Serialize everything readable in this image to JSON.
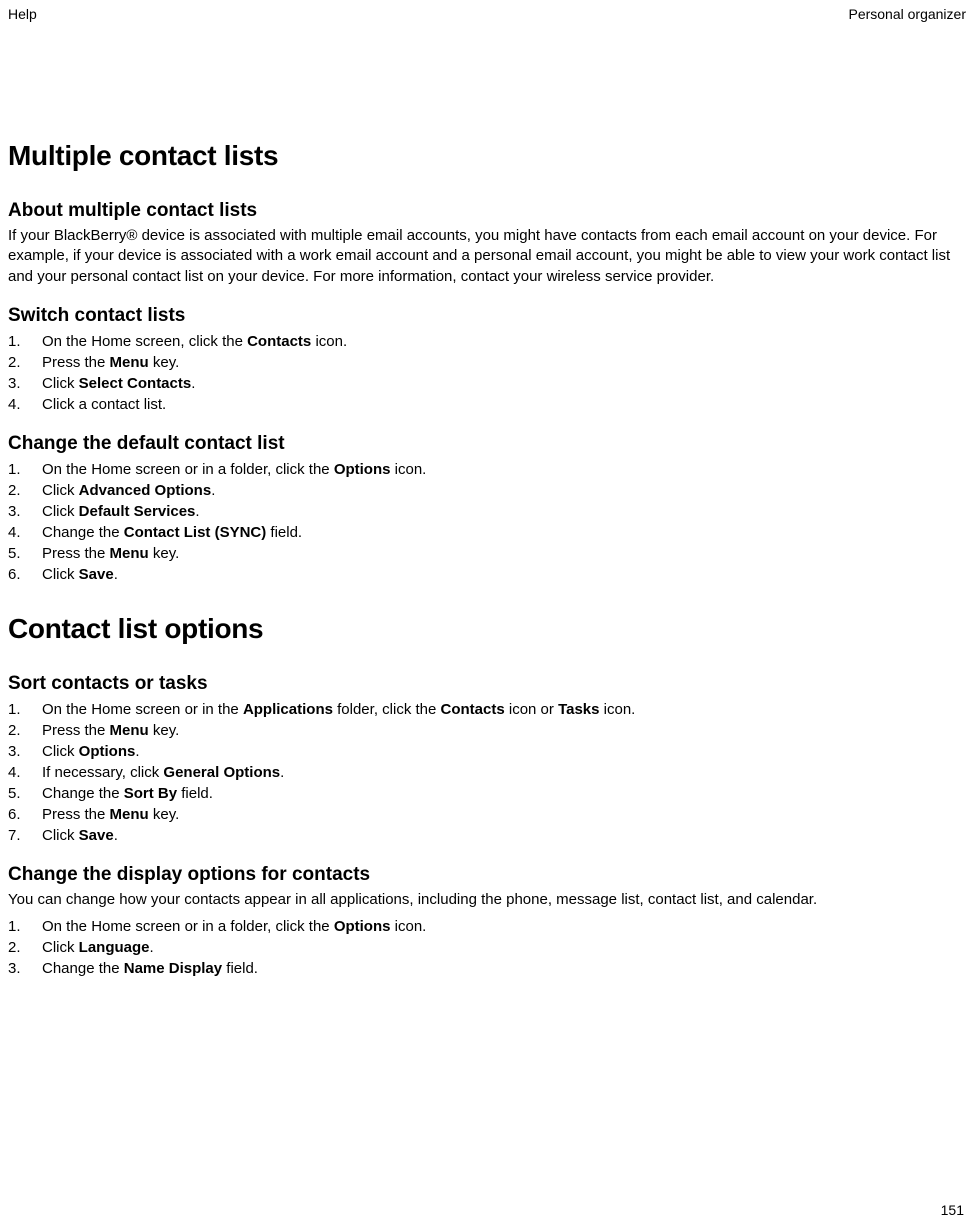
{
  "header": {
    "left": "Help",
    "right": "Personal organizer"
  },
  "page_number": "151",
  "h1a": "Multiple contact lists",
  "sectionA": {
    "title": "About multiple contact lists",
    "para": "If your BlackBerry® device is associated with multiple email accounts, you might have contacts from each email account on your device. For example, if your device is associated with a work email account and a personal email account, you might be able to view your work contact list and your personal contact list on your device. For more information, contact your wireless service provider."
  },
  "sectionB": {
    "title": "Switch contact lists",
    "steps": [
      {
        "pre": "On the Home screen, click the ",
        "bold": "Contacts",
        "post": " icon."
      },
      {
        "pre": "Press the ",
        "bold": "Menu",
        "post": " key."
      },
      {
        "pre": "Click ",
        "bold": "Select Contacts",
        "post": "."
      },
      {
        "pre": "Click a contact list.",
        "bold": "",
        "post": ""
      }
    ]
  },
  "sectionC": {
    "title": "Change the default contact list",
    "steps": [
      {
        "pre": "On the Home screen or in a folder, click the ",
        "bold": "Options",
        "post": " icon."
      },
      {
        "pre": "Click ",
        "bold": "Advanced Options",
        "post": "."
      },
      {
        "pre": "Click ",
        "bold": "Default Services",
        "post": "."
      },
      {
        "pre": "Change the ",
        "bold": "Contact List (SYNC)",
        "post": " field."
      },
      {
        "pre": "Press the ",
        "bold": "Menu",
        "post": " key."
      },
      {
        "pre": "Click ",
        "bold": "Save",
        "post": "."
      }
    ]
  },
  "h1b": "Contact list options",
  "sectionD": {
    "title": "Sort contacts or tasks",
    "steps": [
      {
        "pre": "On the Home screen or in the ",
        "bold": "Applications",
        "mid": " folder, click the ",
        "bold2": "Contacts",
        "mid2": " icon or ",
        "bold3": "Tasks",
        "post": " icon."
      },
      {
        "pre": "Press the ",
        "bold": "Menu",
        "post": " key."
      },
      {
        "pre": "Click ",
        "bold": "Options",
        "post": "."
      },
      {
        "pre": "If necessary, click ",
        "bold": "General Options",
        "post": "."
      },
      {
        "pre": "Change the ",
        "bold": "Sort By",
        "post": " field."
      },
      {
        "pre": "Press the ",
        "bold": "Menu",
        "post": " key."
      },
      {
        "pre": "Click ",
        "bold": "Save",
        "post": "."
      }
    ]
  },
  "sectionE": {
    "title": "Change the display options for contacts",
    "para": "You can change how your contacts appear in all applications, including the phone, message list, contact list, and calendar.",
    "steps": [
      {
        "pre": "On the Home screen or in a folder, click the ",
        "bold": "Options",
        "post": " icon."
      },
      {
        "pre": "Click ",
        "bold": "Language",
        "post": "."
      },
      {
        "pre": "Change the ",
        "bold": "Name Display",
        "post": " field."
      }
    ]
  }
}
